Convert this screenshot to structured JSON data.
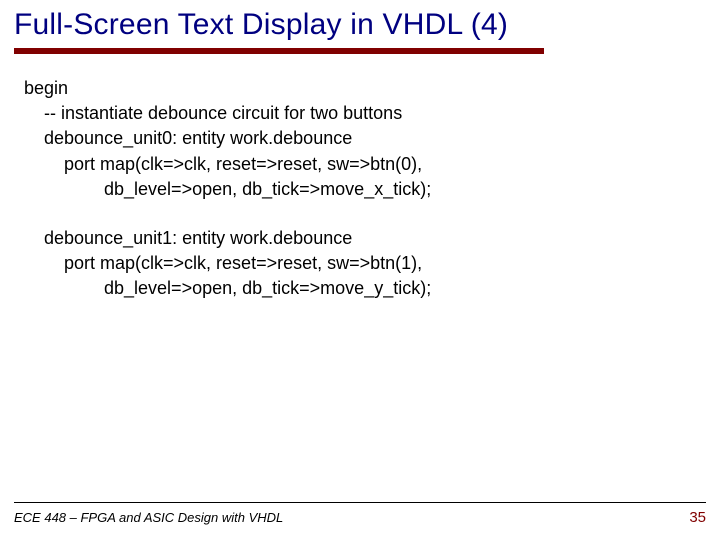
{
  "title": "Full-Screen Text Display in VHDL (4)",
  "code": {
    "l1": "begin",
    "l2": "-- instantiate debounce circuit for two buttons",
    "l3": "debounce_unit0: entity work.debounce",
    "l4": "port map(clk=>clk, reset=>reset, sw=>btn(0),",
    "l5": "db_level=>open, db_tick=>move_x_tick);",
    "l6": "debounce_unit1: entity work.debounce",
    "l7": "port map(clk=>clk, reset=>reset, sw=>btn(1),",
    "l8": "db_level=>open, db_tick=>move_y_tick);"
  },
  "footer": {
    "course": "ECE 448 – FPGA and ASIC Design with VHDL",
    "page": "35"
  }
}
